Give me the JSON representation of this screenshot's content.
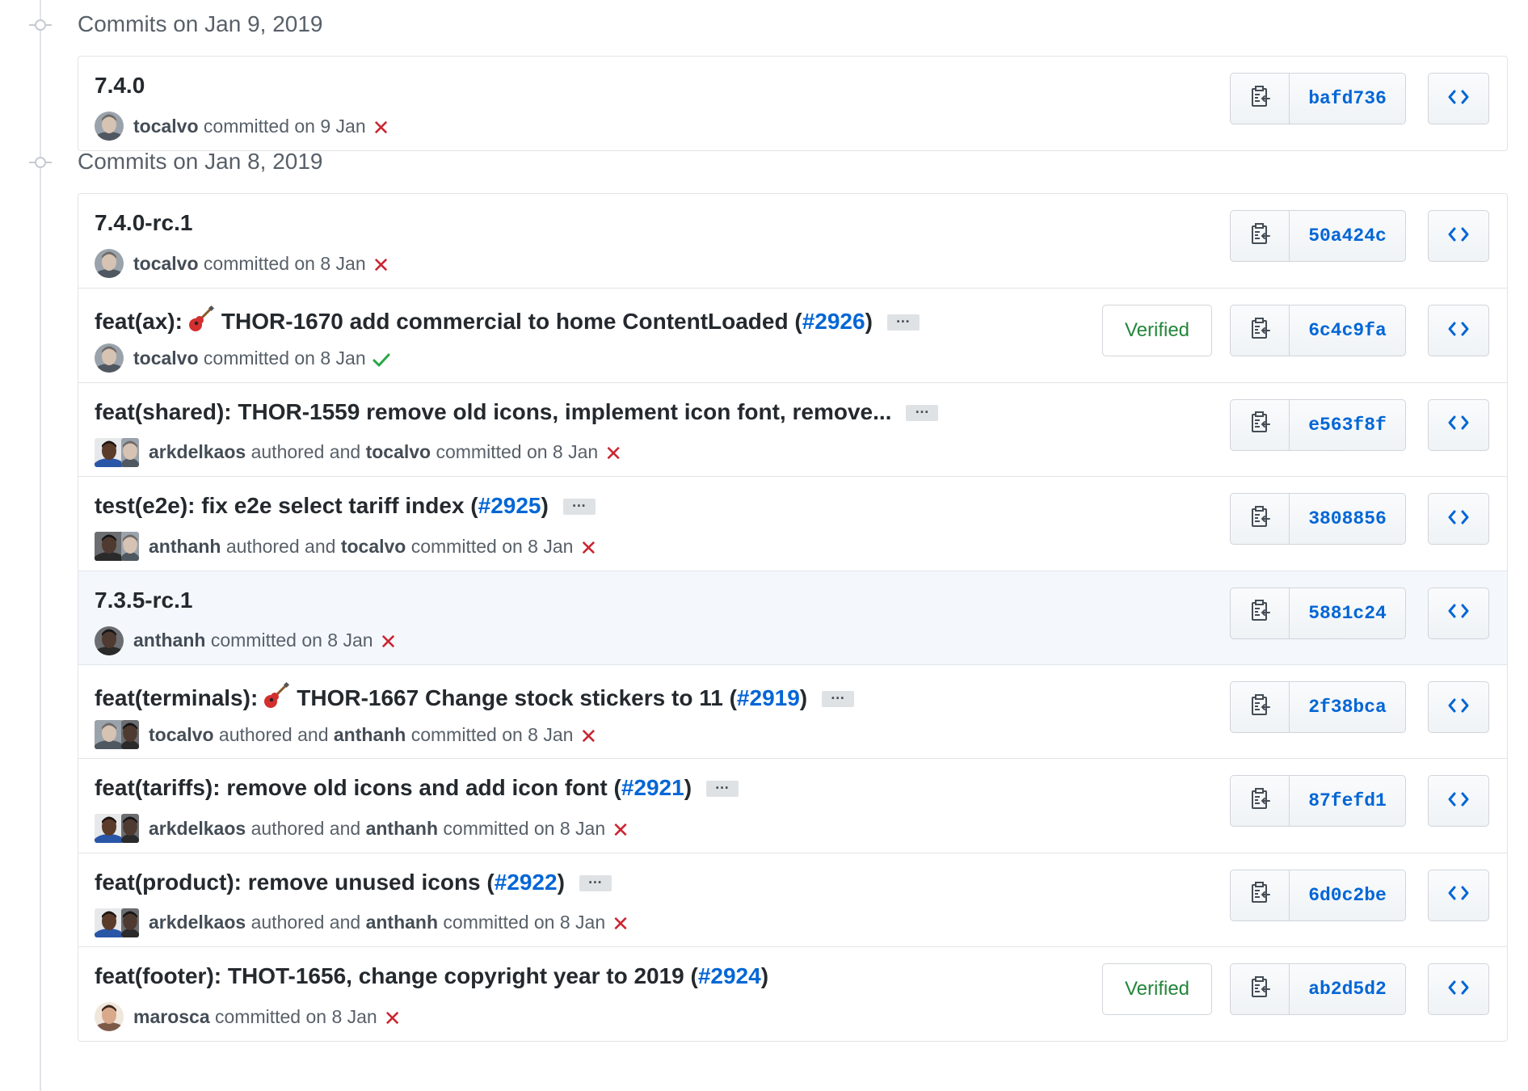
{
  "groups": [
    {
      "title": "Commits on Jan 9, 2019",
      "commits": [
        {
          "message": "7.4.0",
          "pr": "",
          "suffix": "",
          "guitar": false,
          "ellipsis": false,
          "authors": [
            {
              "name": "tocalvo"
            }
          ],
          "role_text": "committed on 9 Jan",
          "status": "failure",
          "verified": false,
          "sha": "bafd736",
          "highlight": false
        }
      ]
    },
    {
      "title": "Commits on Jan 8, 2019",
      "commits": [
        {
          "message": "7.4.0-rc.1",
          "pr": "",
          "suffix": "",
          "guitar": false,
          "ellipsis": false,
          "authors": [
            {
              "name": "tocalvo"
            }
          ],
          "role_text": "committed on 8 Jan",
          "status": "failure",
          "verified": false,
          "sha": "50a424c",
          "highlight": false
        },
        {
          "message_prefix": "feat(ax):",
          "message": "THOR-1670 add commercial to home ContentLoaded (",
          "pr": "#2926",
          "suffix": ")",
          "guitar": true,
          "ellipsis": true,
          "authors": [
            {
              "name": "tocalvo"
            }
          ],
          "role_text": "committed on 8 Jan",
          "status": "success",
          "verified": true,
          "verified_label": "Verified",
          "sha": "6c4c9fa",
          "highlight": false
        },
        {
          "message": "feat(shared): THOR-1559 remove old icons, implement icon font, remove...",
          "pr": "",
          "suffix": "",
          "guitar": false,
          "ellipsis": true,
          "authors": [
            {
              "name": "arkdelkaos"
            },
            {
              "name": "tocalvo"
            }
          ],
          "role_text": "committed on 8 Jan",
          "status": "failure",
          "verified": false,
          "sha": "e563f8f",
          "highlight": false
        },
        {
          "message": "test(e2e): fix e2e select tariff index (",
          "pr": "#2925",
          "suffix": ")",
          "guitar": false,
          "ellipsis": true,
          "authors": [
            {
              "name": "anthanh"
            },
            {
              "name": "tocalvo"
            }
          ],
          "role_text": "committed on 8 Jan",
          "status": "failure",
          "verified": false,
          "sha": "3808856",
          "highlight": false
        },
        {
          "message": "7.3.5-rc.1",
          "pr": "",
          "suffix": "",
          "guitar": false,
          "ellipsis": false,
          "authors": [
            {
              "name": "anthanh"
            }
          ],
          "role_text": "committed on 8 Jan",
          "status": "failure",
          "verified": false,
          "sha": "5881c24",
          "highlight": true
        },
        {
          "message_prefix": "feat(terminals):",
          "message": "THOR-1667 Change stock stickers to 11 (",
          "pr": "#2919",
          "suffix": ")",
          "guitar": true,
          "ellipsis": true,
          "authors": [
            {
              "name": "tocalvo"
            },
            {
              "name": "anthanh"
            }
          ],
          "role_text": "committed on 8 Jan",
          "status": "failure",
          "verified": false,
          "sha": "2f38bca",
          "highlight": false
        },
        {
          "message": "feat(tariffs): remove old icons and add icon font (",
          "pr": "#2921",
          "suffix": ")",
          "guitar": false,
          "ellipsis": true,
          "authors": [
            {
              "name": "arkdelkaos"
            },
            {
              "name": "anthanh"
            }
          ],
          "role_text": "committed on 8 Jan",
          "status": "failure",
          "verified": false,
          "sha": "87fefd1",
          "highlight": false
        },
        {
          "message": "feat(product): remove unused icons (",
          "pr": "#2922",
          "suffix": ")",
          "guitar": false,
          "ellipsis": true,
          "authors": [
            {
              "name": "arkdelkaos"
            },
            {
              "name": "anthanh"
            }
          ],
          "role_text": "committed on 8 Jan",
          "status": "failure",
          "verified": false,
          "sha": "6d0c2be",
          "highlight": false
        },
        {
          "message": "feat(footer): THOT-1656, change copyright year to 2019 (",
          "pr": "#2924",
          "suffix": ")",
          "guitar": false,
          "ellipsis": false,
          "authors": [
            {
              "name": "marosca"
            }
          ],
          "role_text": "committed on 8 Jan",
          "status": "failure",
          "verified": true,
          "verified_label": "Verified",
          "sha": "ab2d5d2",
          "highlight": false
        }
      ]
    }
  ],
  "strings": {
    "authored_and": "authored and",
    "ellipsis": "…"
  },
  "colors": {
    "link": "#0366d6",
    "failure": "#cb2431",
    "success": "#28a745",
    "verified": "#22863a",
    "highlight_row": "#f4f8fd"
  },
  "avatar_styles": {
    "tocalvo": "grey-man",
    "arkdelkaos": "dark-man-blue-shirt",
    "anthanh": "dark-photo",
    "marosca": "woman-dark-hair"
  }
}
